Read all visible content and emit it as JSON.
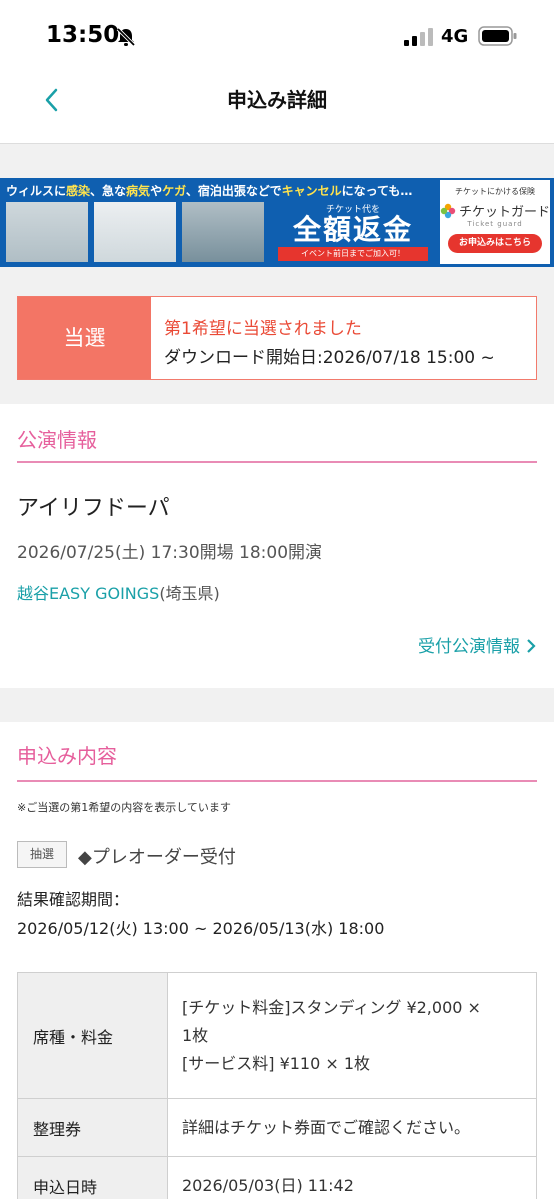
{
  "status_bar": {
    "time": "13:50",
    "network": "4G"
  },
  "nav": {
    "title": "申込み詳細"
  },
  "banner": {
    "top_text_parts": [
      "ウィルスに",
      "感染",
      "、急な",
      "病気",
      "や",
      "ケガ",
      "、宿泊出張などで",
      "キャンセル",
      "になっても…"
    ],
    "sub": "チケット代を",
    "main": "全額返金",
    "strip": "イベント前日までご加入可！",
    "right_small": "チケットにかける保険",
    "right_logo": "チケットガード",
    "right_logo_sub": "Ticket guard",
    "right_button": "お申込みはこちら"
  },
  "result": {
    "badge": "当選",
    "headline": "第1希望に当選されました",
    "download": "ダウンロード開始日:2026/07/18 15:00 ~"
  },
  "performance": {
    "section_title": "公演情報",
    "name": "アイリフドーパ",
    "datetime": "2026/07/25(土) 17:30開場 18:00開演",
    "venue_name": "越谷EASY GOINGS",
    "venue_pref": "(埼玉県)",
    "info_link": "受付公演情報"
  },
  "application": {
    "section_title": "申込み内容",
    "note": "※ご当選の第1希望の内容を表示しています",
    "tag": "抽選",
    "reception": "◆プレオーダー受付",
    "period_label": "結果確認期間：",
    "period_value": "2026/05/12(火) 13:00 ~ 2026/05/13(水) 18:00",
    "table": [
      {
        "key": "席種・料金",
        "lines": [
          "[チケット料金]スタンディング ¥2,000 ×",
          "1枚",
          "[サービス料] ¥110 × 1枚"
        ]
      },
      {
        "key": "整理券",
        "lines": [
          "詳細はチケット券面でご確認ください。"
        ]
      },
      {
        "key": "申込日時",
        "lines": [
          "2026/05/03(日) 11:42"
        ]
      }
    ]
  },
  "colors": {
    "accent_pink": "#e65f9c",
    "accent_teal": "#1aa0a8",
    "win_red": "#f37565",
    "banner_blue": "#0f5fb0"
  }
}
